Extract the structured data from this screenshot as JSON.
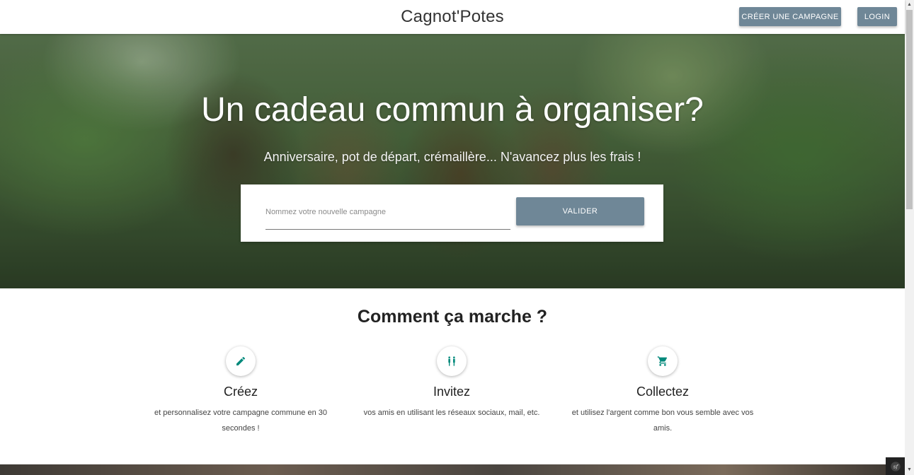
{
  "navbar": {
    "brand": "Cagnot'Potes",
    "create_campaign_label": "CRÉER UNE CAMPAGNE",
    "login_label": "LOGIN"
  },
  "hero": {
    "title": "Un cadeau commun à organiser?",
    "subtitle": "Anniversaire, pot de départ, crémaillère... N'avancez plus les frais !",
    "input_placeholder": "Nommez votre nouvelle campagne",
    "input_value": "",
    "submit_label": "VALIDER"
  },
  "how_it_works": {
    "title": "Comment ça marche ?",
    "steps": [
      {
        "icon": "pencil-icon",
        "title": "Créez",
        "description": "et personnalisez votre campagne commune en 30 secondes !"
      },
      {
        "icon": "people-icon",
        "title": "Invitez",
        "description": "vos amis en utilisant les réseaux sociaux, mail, etc."
      },
      {
        "icon": "cart-icon",
        "title": "Collectez",
        "description": "et utilisez l'argent comme bon vous semble avec vos amis."
      }
    ]
  },
  "colors": {
    "accent": "#6f8797",
    "icon_teal": "#00897b"
  }
}
